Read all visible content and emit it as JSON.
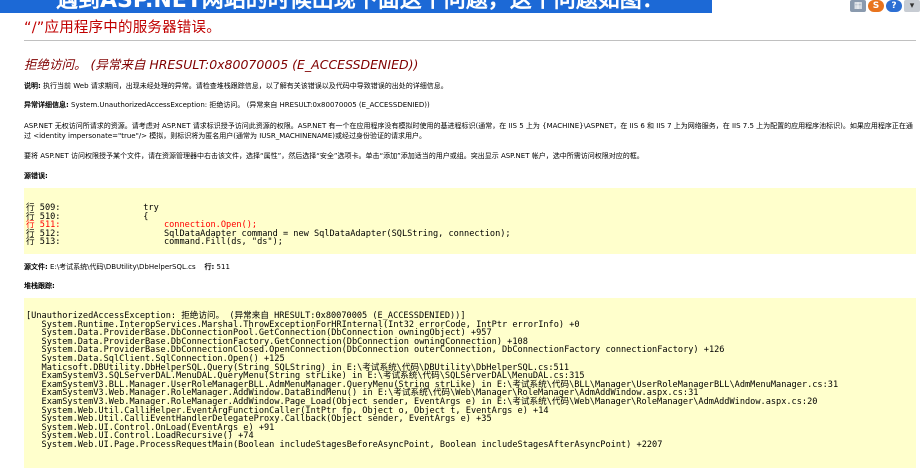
{
  "banner_text": "遇到ASP.NET网站的时候出现下面这个问题，这个问题如图：",
  "tray": {
    "grid": "▦",
    "s": "S",
    "help": "?",
    "chevron": "▾"
  },
  "server_title": "“/”应用程序中的服务器错误。",
  "error_title": "拒绝访问。 (异常来自 HRESULT:0x80070005 (E_ACCESSDENIED))",
  "description": {
    "label": "说明:",
    "text": " 执行当前 Web 请求期间，出现未经处理的异常。请检查堆栈跟踪信息，以了解有关该错误以及代码中导致错误的出处的详细信息。"
  },
  "exception_details": {
    "label": "异常详细信息:",
    "text": " System.UnauthorizedAccessException: 拒绝访问。 (异常来自 HRESULT:0x80070005 (E_ACCESSDENIED))"
  },
  "para1": "ASP.NET 无权访问所请求的资源。请考虑对 ASP.NET 请求标识授予访问此资源的权限。ASP.NET 有一个在应用程序没有模拟时使用的基进程标识(通常，在 IIS 5 上为 {MACHINE}\\ASPNET，在 IIS 6 和 IIS 7 上为网络服务，在 IIS 7.5 上为配置的应用程序池标识)。如果应用程序正在通过 <identity impersonate=\"true\"/> 模拟，则标识将为匿名用户(通常为 IUSR_MACHINENAME)或经过身份验证的请求用户。",
  "para2": "要将 ASP.NET 访问权限授予某个文件，请在资源管理器中右击该文件，选择“属性”，然后选择“安全”选项卡。单击“添加”添加适当的用户或组。突出显示 ASP.NET 帐户，选中所需访问权限对应的框。",
  "source_error_label": "源错误:",
  "source_lines": [
    {
      "no": "行 509:",
      "code": "                try",
      "highlight": false
    },
    {
      "no": "行 510:",
      "code": "                {",
      "highlight": false
    },
    {
      "no": "行 511:",
      "code": "                    connection.Open();",
      "highlight": true
    },
    {
      "no": "行 512:",
      "code": "                    SqlDataAdapter command = new SqlDataAdapter(SQLString, connection);",
      "highlight": false
    },
    {
      "no": "行 513:",
      "code": "                    command.Fill(ds, \"ds\");",
      "highlight": false
    }
  ],
  "source_file": {
    "label": "源文件:",
    "path": " E:\\考试系统\\代码\\DBUtility\\DbHelperSQL.cs",
    "line_label": "行:",
    "line_value": " 511"
  },
  "stack_trace_label": "堆栈跟踪:",
  "stack_lines": [
    "[UnauthorizedAccessException: 拒绝访问。 (异常来自 HRESULT:0x80070005 (E_ACCESSDENIED))]",
    "   System.Runtime.InteropServices.Marshal.ThrowExceptionForHRInternal(Int32 errorCode, IntPtr errorInfo) +0",
    "   System.Data.ProviderBase.DbConnectionPool.GetConnection(DbConnection owningObject) +957",
    "   System.Data.ProviderBase.DbConnectionFactory.GetConnection(DbConnection owningConnection) +108",
    "   System.Data.ProviderBase.DbConnectionClosed.OpenConnection(DbConnection outerConnection, DbConnectionFactory connectionFactory) +126",
    "   System.Data.SqlClient.SqlConnection.Open() +125",
    "   Maticsoft.DBUtility.DbHelperSQL.Query(String SQLString) in E:\\考试系统\\代码\\DBUtility\\DbHelperSQL.cs:511",
    "   ExamSystemV3.SQLServerDAL.MenuDAL.QueryMenu(String strLike) in E:\\考试系统\\代码\\SQLServerDAL\\MenuDAL.cs:315",
    "   ExamSystemV3.BLL.Manager.UserRoleManagerBLL.AdmMenuManager.QueryMenu(String strLike) in E:\\考试系统\\代码\\BLL\\Manager\\UserRoleManagerBLL\\AdmMenuManager.cs:31",
    "   ExamSystemV3.Web.Manager.RoleManager.AddWindow.DataBindMenu() in E:\\考试系统\\代码\\Web\\Manager\\RoleManager\\AdmAddWindow.aspx.cs:31",
    "   ExamSystemV3.Web.Manager.RoleManager.AddWindow.Page_Load(Object sender, EventArgs e) in E:\\考试系统\\代码\\Web\\Manager\\RoleManager\\AdmAddWindow.aspx.cs:20",
    "   System.Web.Util.CalliHelper.EventArgFunctionCaller(IntPtr fp, Object o, Object t, EventArgs e) +14",
    "   System.Web.Util.CalliEventHandlerDelegateProxy.Callback(Object sender, EventArgs e) +35",
    "   System.Web.UI.Control.OnLoad(EventArgs e) +91",
    "   System.Web.UI.Control.LoadRecursive() +74",
    "   System.Web.UI.Page.ProcessRequestMain(Boolean includeStagesBeforeAsyncPoint, Boolean includeStagesAfterAsyncPoint) +2207"
  ],
  "colors": {
    "title_red": "#c00000",
    "error_maroon": "#800000",
    "code_bg": "#ffffcc",
    "highlight": "#ff0000",
    "banner": "#1c69d6"
  }
}
